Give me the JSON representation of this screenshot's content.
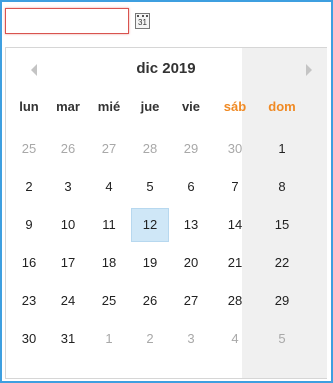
{
  "input": {
    "value": "",
    "placeholder": ""
  },
  "calendar_button": {
    "icon": "calendar-icon",
    "label": "31"
  },
  "picker": {
    "title": "dic 2019",
    "prev_icon": "chevron-left-icon",
    "next_icon": "chevron-right-icon",
    "weekdays": [
      "lun",
      "mar",
      "mié",
      "jue",
      "vie",
      "sáb",
      "dom"
    ],
    "weeks": [
      [
        {
          "d": "25",
          "other": true
        },
        {
          "d": "26",
          "other": true
        },
        {
          "d": "27",
          "other": true
        },
        {
          "d": "28",
          "other": true
        },
        {
          "d": "29",
          "other": true
        },
        {
          "d": "30",
          "other": true
        },
        {
          "d": "1"
        }
      ],
      [
        {
          "d": "2"
        },
        {
          "d": "3"
        },
        {
          "d": "4"
        },
        {
          "d": "5"
        },
        {
          "d": "6"
        },
        {
          "d": "7"
        },
        {
          "d": "8"
        }
      ],
      [
        {
          "d": "9"
        },
        {
          "d": "10"
        },
        {
          "d": "11"
        },
        {
          "d": "12",
          "selected": true
        },
        {
          "d": "13"
        },
        {
          "d": "14"
        },
        {
          "d": "15"
        }
      ],
      [
        {
          "d": "16"
        },
        {
          "d": "17"
        },
        {
          "d": "18"
        },
        {
          "d": "19"
        },
        {
          "d": "20"
        },
        {
          "d": "21"
        },
        {
          "d": "22"
        }
      ],
      [
        {
          "d": "23"
        },
        {
          "d": "24"
        },
        {
          "d": "25"
        },
        {
          "d": "26"
        },
        {
          "d": "27"
        },
        {
          "d": "28"
        },
        {
          "d": "29"
        }
      ],
      [
        {
          "d": "30"
        },
        {
          "d": "31"
        },
        {
          "d": "1",
          "other": true
        },
        {
          "d": "2",
          "other": true
        },
        {
          "d": "3",
          "other": true
        },
        {
          "d": "4",
          "other": true
        },
        {
          "d": "5",
          "other": true
        }
      ]
    ]
  },
  "colors": {
    "frame_border": "#3e9fe0",
    "input_border": "#d9534f",
    "weekend_header": "#f08a24",
    "weekend_bg": "#f0f0f0",
    "selected_bg": "#cfe7f7",
    "other_month_text": "#a8a8a8"
  }
}
